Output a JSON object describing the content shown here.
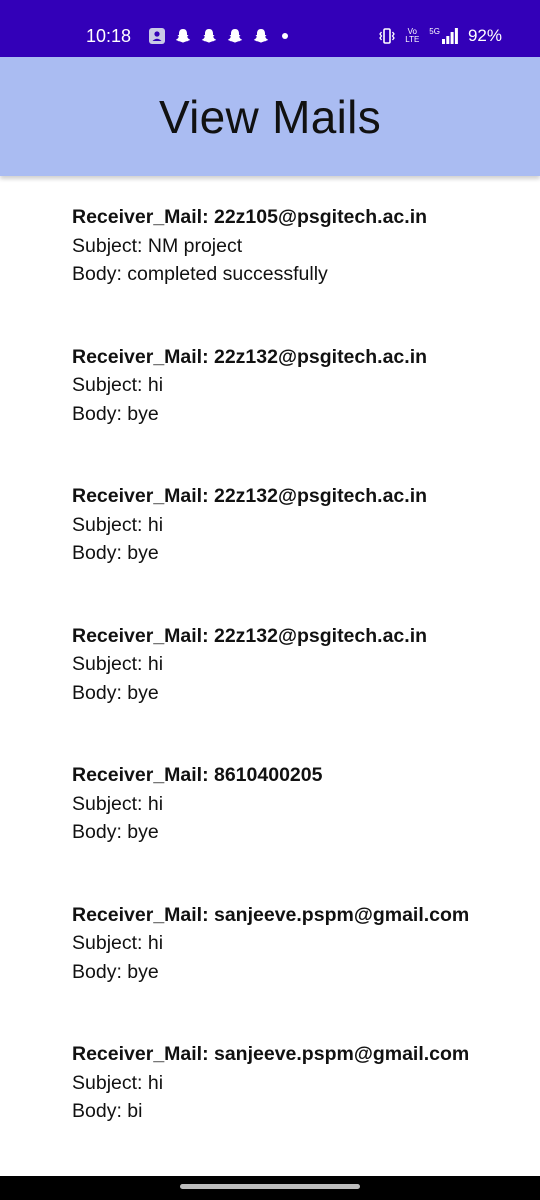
{
  "status_bar": {
    "time": "10:18",
    "battery": "92%",
    "volte_label": "Vo LTE",
    "network_label": "5G"
  },
  "app_bar": {
    "title": "View Mails"
  },
  "mails": [
    {
      "receiver": "Receiver_Mail: 22z105@psgitech.ac.in",
      "subject": "Subject: NM project",
      "body": "Body: completed successfully"
    },
    {
      "receiver": "Receiver_Mail: 22z132@psgitech.ac.in",
      "subject": "Subject: hi",
      "body": "Body: bye"
    },
    {
      "receiver": "Receiver_Mail: 22z132@psgitech.ac.in",
      "subject": "Subject: hi",
      "body": "Body: bye"
    },
    {
      "receiver": "Receiver_Mail: 22z132@psgitech.ac.in",
      "subject": "Subject: hi",
      "body": "Body: bye"
    },
    {
      "receiver": "Receiver_Mail: 8610400205",
      "subject": "Subject: hi",
      "body": "Body: bye"
    },
    {
      "receiver": "Receiver_Mail: sanjeeve.pspm@gmail.com",
      "subject": "Subject: hi",
      "body": "Body: bye"
    },
    {
      "receiver": "Receiver_Mail: sanjeeve.pspm@gmail.com",
      "subject": "Subject: hi",
      "body": "Body: bi"
    }
  ],
  "colors": {
    "status_bar_bg": "#3300b8",
    "app_bar_bg": "#aabcf2",
    "text": "#111111"
  }
}
